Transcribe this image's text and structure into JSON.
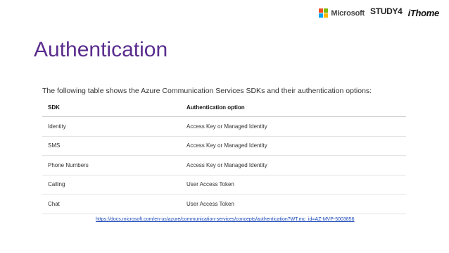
{
  "header": {
    "logos": {
      "microsoft": "Microsoft",
      "microsoft_colors": [
        "#f25022",
        "#7fba00",
        "#00a4ef",
        "#ffb900"
      ],
      "study4": "STUDY4",
      "study4_sub": "",
      "ithome": "iThome"
    }
  },
  "slide": {
    "title": "Authentication",
    "title_color": "#5b2d8e",
    "intro": "The following table shows the Azure Communication Services SDKs and their authentication options:"
  },
  "table": {
    "headers": [
      "SDK",
      "Authentication option"
    ],
    "rows": [
      [
        "Identity",
        "Access Key or Managed Identity"
      ],
      [
        "SMS",
        "Access Key or Managed Identity"
      ],
      [
        "Phone Numbers",
        "Access Key or Managed Identity"
      ],
      [
        "Calling",
        "User Access Token"
      ],
      [
        "Chat",
        "User Access Token"
      ]
    ]
  },
  "source": {
    "url": "https://docs.microsoft.com/en-us/azure/communication-services/concepts/authentication?WT.mc_id=AZ-MVP-5003856"
  }
}
